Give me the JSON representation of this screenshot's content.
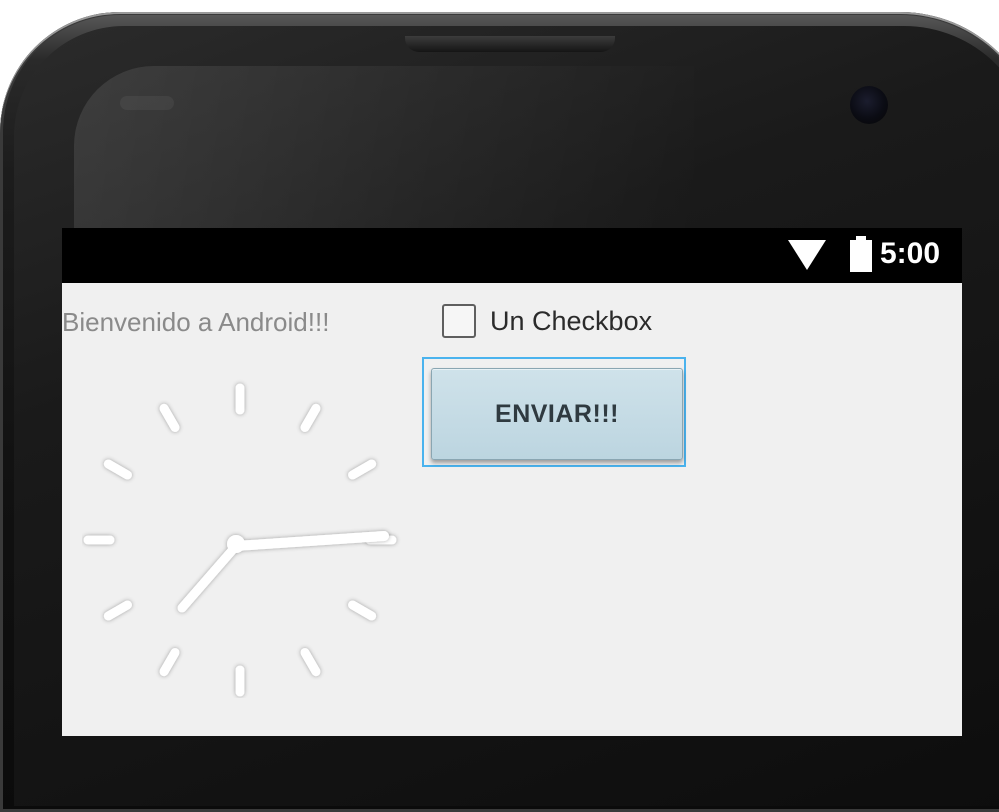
{
  "status_bar": {
    "time": "5:00",
    "icons": [
      "wifi-icon",
      "battery-icon"
    ]
  },
  "app": {
    "welcome_text": "Bienvenido a Android!!!",
    "checkbox_label": "Un Checkbox",
    "checkbox_checked": false,
    "button_label": "ENVIAR!!!",
    "button_focused": true
  },
  "colors": {
    "screen_background": "#f0f0f0",
    "status_bar": "#000000",
    "focus_outline": "#4ab3ee",
    "button_fill": "#c4dae4"
  }
}
